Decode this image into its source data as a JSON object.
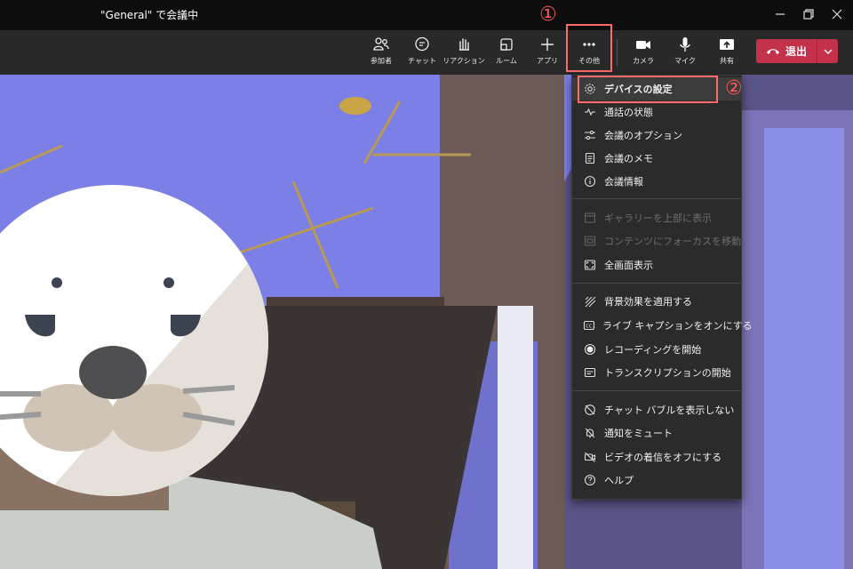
{
  "window": {
    "title": "\"General\" で会議中"
  },
  "toolbar": {
    "buttons": [
      {
        "label": "参加者",
        "icon": "people-icon"
      },
      {
        "label": "チャット",
        "icon": "chat-icon"
      },
      {
        "label": "リアクション",
        "icon": "reaction-hand-icon"
      },
      {
        "label": "ルーム",
        "icon": "breakout-room-icon"
      },
      {
        "label": "アプリ",
        "icon": "plus-icon"
      },
      {
        "label": "その他",
        "icon": "more-ellipsis-icon"
      },
      {
        "label": "カメラ",
        "icon": "camera-icon"
      },
      {
        "label": "マイク",
        "icon": "microphone-icon"
      },
      {
        "label": "共有",
        "icon": "share-screen-icon"
      }
    ],
    "leave_label": "退出"
  },
  "annotations": {
    "step1": "①",
    "step2": "②"
  },
  "menu": {
    "items": [
      {
        "label": "デバイスの設定",
        "icon": "gear-icon",
        "disabled": false
      },
      {
        "label": "通話の状態",
        "icon": "pulse-icon",
        "disabled": false
      },
      {
        "label": "会議のオプション",
        "icon": "sliders-icon",
        "disabled": false
      },
      {
        "label": "会議のメモ",
        "icon": "notes-icon",
        "disabled": false
      },
      {
        "label": "会議情報",
        "icon": "info-icon",
        "disabled": false
      },
      {
        "label": "ギャラリーを上部に表示",
        "icon": "gallery-top-icon",
        "disabled": true
      },
      {
        "label": "コンテンツにフォーカスを移動",
        "icon": "focus-content-icon",
        "disabled": true
      },
      {
        "label": "全画面表示",
        "icon": "fullscreen-icon",
        "disabled": false
      },
      {
        "label": "背景効果を適用する",
        "icon": "background-effects-icon",
        "disabled": false
      },
      {
        "label": "ライブ キャプションをオンにする",
        "icon": "captions-icon",
        "disabled": false
      },
      {
        "label": "レコーディングを開始",
        "icon": "record-icon",
        "disabled": false
      },
      {
        "label": "トランスクリプションの開始",
        "icon": "transcript-icon",
        "disabled": false
      },
      {
        "label": "チャット バブルを表示しない",
        "icon": "chat-bubble-off-icon",
        "disabled": false
      },
      {
        "label": "通知をミュート",
        "icon": "bell-off-icon",
        "disabled": false
      },
      {
        "label": "ビデオの着信をオフにする",
        "icon": "video-off-icon",
        "disabled": false
      },
      {
        "label": "ヘルプ",
        "icon": "help-icon",
        "disabled": false
      }
    ]
  },
  "colors": {
    "leave": "#c4314b",
    "annotation": "#ff5a5a",
    "menu_bg": "#2b2b2b"
  }
}
